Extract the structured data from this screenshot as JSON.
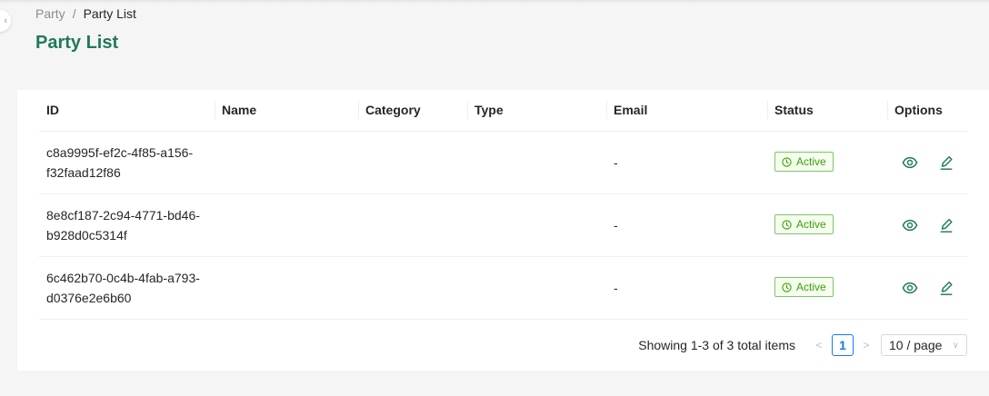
{
  "breadcrumb": {
    "parent": "Party",
    "separator": "/",
    "current": "Party List"
  },
  "page_title": "Party List",
  "table": {
    "columns": [
      "ID",
      "Name",
      "Category",
      "Type",
      "Email",
      "Status",
      "Options"
    ],
    "rows": [
      {
        "id": "c8a9995f-ef2c-4f85-a156-\nf32faad12f86",
        "name": "",
        "category": "",
        "type": "",
        "email": "-",
        "status": "Active"
      },
      {
        "id": "8e8cf187-2c94-4771-bd46-\nb928d0c5314f",
        "name": "",
        "category": "",
        "type": "",
        "email": "-",
        "status": "Active"
      },
      {
        "id": "6c462b70-0c4b-4fab-a793-\nd0376e2e6b60",
        "name": "",
        "category": "",
        "type": "",
        "email": "-",
        "status": "Active"
      }
    ]
  },
  "pagination": {
    "total_text": "Showing 1-3 of 3 total items",
    "current_page": "1",
    "page_size": "10 / page"
  },
  "icons": {
    "view": "eye-icon",
    "edit": "edit-icon",
    "status": "clock-icon",
    "prev": "chevron-left-icon",
    "next": "chevron-right-icon"
  },
  "colors": {
    "accent_green": "#1f7a5a",
    "status_green": "#389e0d",
    "pagination_blue": "#1677ff"
  }
}
